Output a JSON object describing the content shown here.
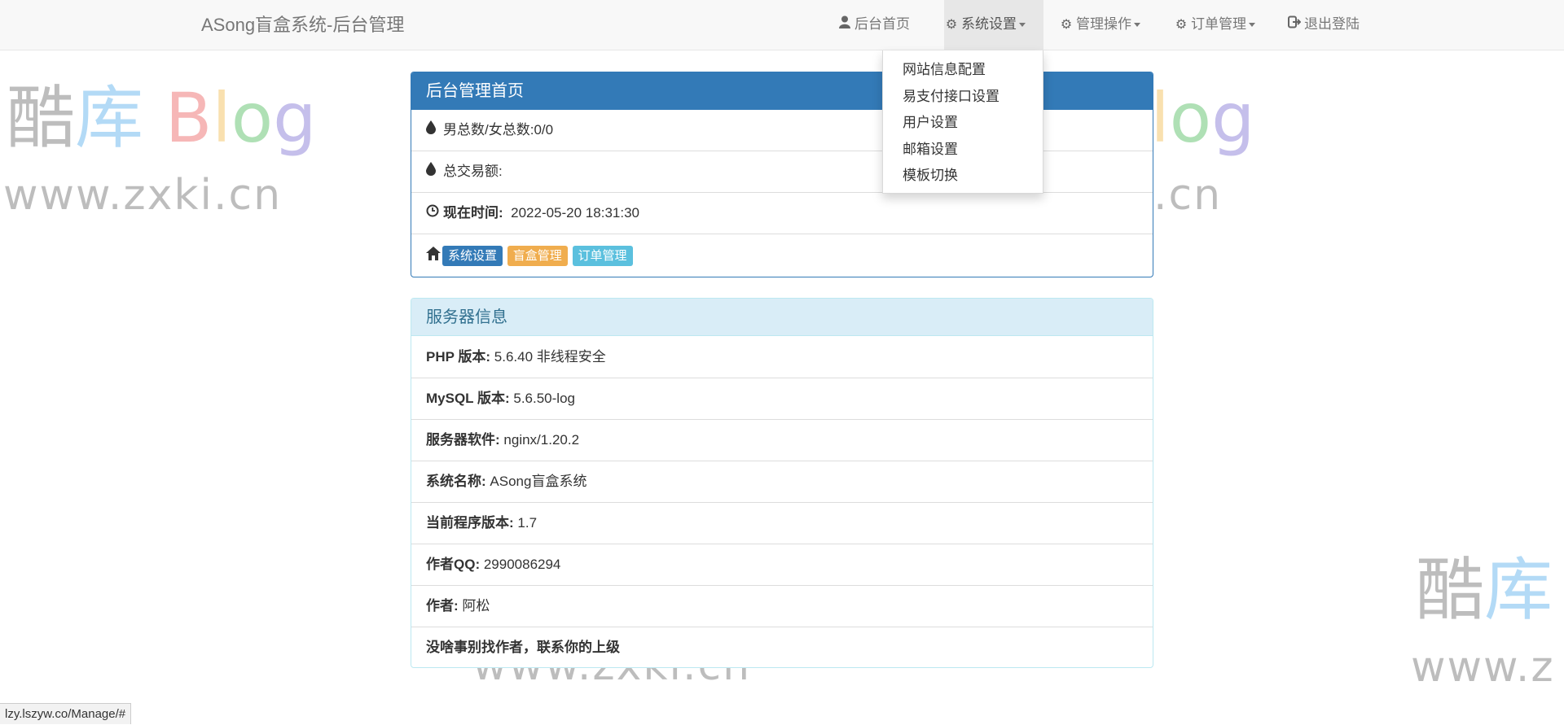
{
  "navbar": {
    "brand": "ASong盲盒系统-后台管理",
    "items": [
      {
        "label": "后台首页",
        "icon": "user-icon"
      },
      {
        "label": "系统设置",
        "icon": "gear-icon"
      },
      {
        "label": "管理操作",
        "icon": "gear-icon"
      },
      {
        "label": "订单管理",
        "icon": "gear-icon"
      },
      {
        "label": "退出登陆",
        "icon": "logout-icon"
      }
    ]
  },
  "dropdown": {
    "items": [
      "网站信息配置",
      "易支付接口设置",
      "用户设置",
      "邮箱设置",
      "模板切换"
    ]
  },
  "admin_panel": {
    "title": "后台管理首页",
    "gender_label": "男总数/女总数:",
    "gender_value": "0/0",
    "trade_label": "总交易额:",
    "trade_value": "",
    "time_label": "现在时间:",
    "time_value": "2022-05-20 18:31:30",
    "buttons": [
      {
        "label": "系统设置",
        "color": "#337ab7"
      },
      {
        "label": "盲盒管理",
        "color": "#f0ad4e"
      },
      {
        "label": "订单管理",
        "color": "#5bc0de"
      }
    ]
  },
  "server_panel": {
    "title": "服务器信息",
    "rows": [
      {
        "label": "PHP 版本:",
        "value": "5.6.40 非线程安全"
      },
      {
        "label": "MySQL 版本:",
        "value": "5.6.50-log"
      },
      {
        "label": "服务器软件:",
        "value": "nginx/1.20.2"
      },
      {
        "label": "系统名称:",
        "value": "ASong盲盒系统"
      },
      {
        "label": "当前程序版本:",
        "value": "1.7"
      },
      {
        "label": "作者QQ:",
        "value": "2990086294"
      },
      {
        "label": "作者:",
        "value": "阿松"
      },
      {
        "label": "没啥事别找作者，联系你的上级",
        "value": ""
      }
    ]
  },
  "watermark": {
    "chars": [
      "酷",
      "库",
      "B",
      "l",
      "o",
      "g"
    ],
    "url": "www.zxki.cn",
    "url_partial": "www.z"
  },
  "statusbar": {
    "url": "lzy.lszyw.co/Manage/#"
  }
}
